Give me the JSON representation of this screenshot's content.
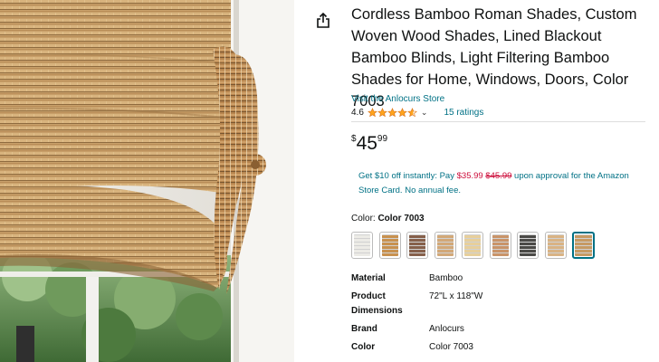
{
  "product": {
    "title": "Cordless Bamboo Roman Shades, Custom Woven Wood Shades, Lined Blackout Bamboo Blinds, Light Filtering Bamboo Shades for Home, Windows, Doors, Color 7003",
    "store_link": "Visit the Anlocurs Store",
    "rating": "4.6",
    "rating_count_label": "15 ratings",
    "stars_value": 4.6,
    "chevron_icon": "chevron-down-icon",
    "share_icon": "share-icon"
  },
  "price": {
    "symbol": "$",
    "whole": "45",
    "fraction": "99"
  },
  "promo": {
    "prefix": "Get $10 off instantly: Pay ",
    "deal_price": "$35.99",
    "strike_price": "$45.99",
    "suffix": " upon approval for the Amazon Store Card. No annual fee."
  },
  "color": {
    "label": "Color: ",
    "selected": "Color 7003",
    "swatches": [
      {
        "name": "white",
        "color": "#ecebe6"
      },
      {
        "name": "light-wood",
        "color": "#c8914f"
      },
      {
        "name": "walnut",
        "color": "#86604b"
      },
      {
        "name": "tan",
        "color": "#d2a878"
      },
      {
        "name": "pale-bamboo",
        "color": "#e7cf9b"
      },
      {
        "name": "honey",
        "color": "#c99469"
      },
      {
        "name": "dark-gray",
        "color": "#4b4a47"
      },
      {
        "name": "natural-stripe",
        "color": "#d9b384"
      },
      {
        "name": "color-7003",
        "color": "#c69a63"
      }
    ],
    "selected_index": 8,
    "accent": "#007185"
  },
  "specs": [
    {
      "label": "Material",
      "value": "Bamboo"
    },
    {
      "label": "Product Dimensions",
      "value": "72\"L x 118\"W"
    },
    {
      "label": "Brand",
      "value": "Anlocurs"
    },
    {
      "label": "Color",
      "value": "Color 7003"
    }
  ],
  "colors": {
    "link": "#007185",
    "deal": "#CC0C39",
    "star": "#FFA41C",
    "text": "#0F1111"
  }
}
